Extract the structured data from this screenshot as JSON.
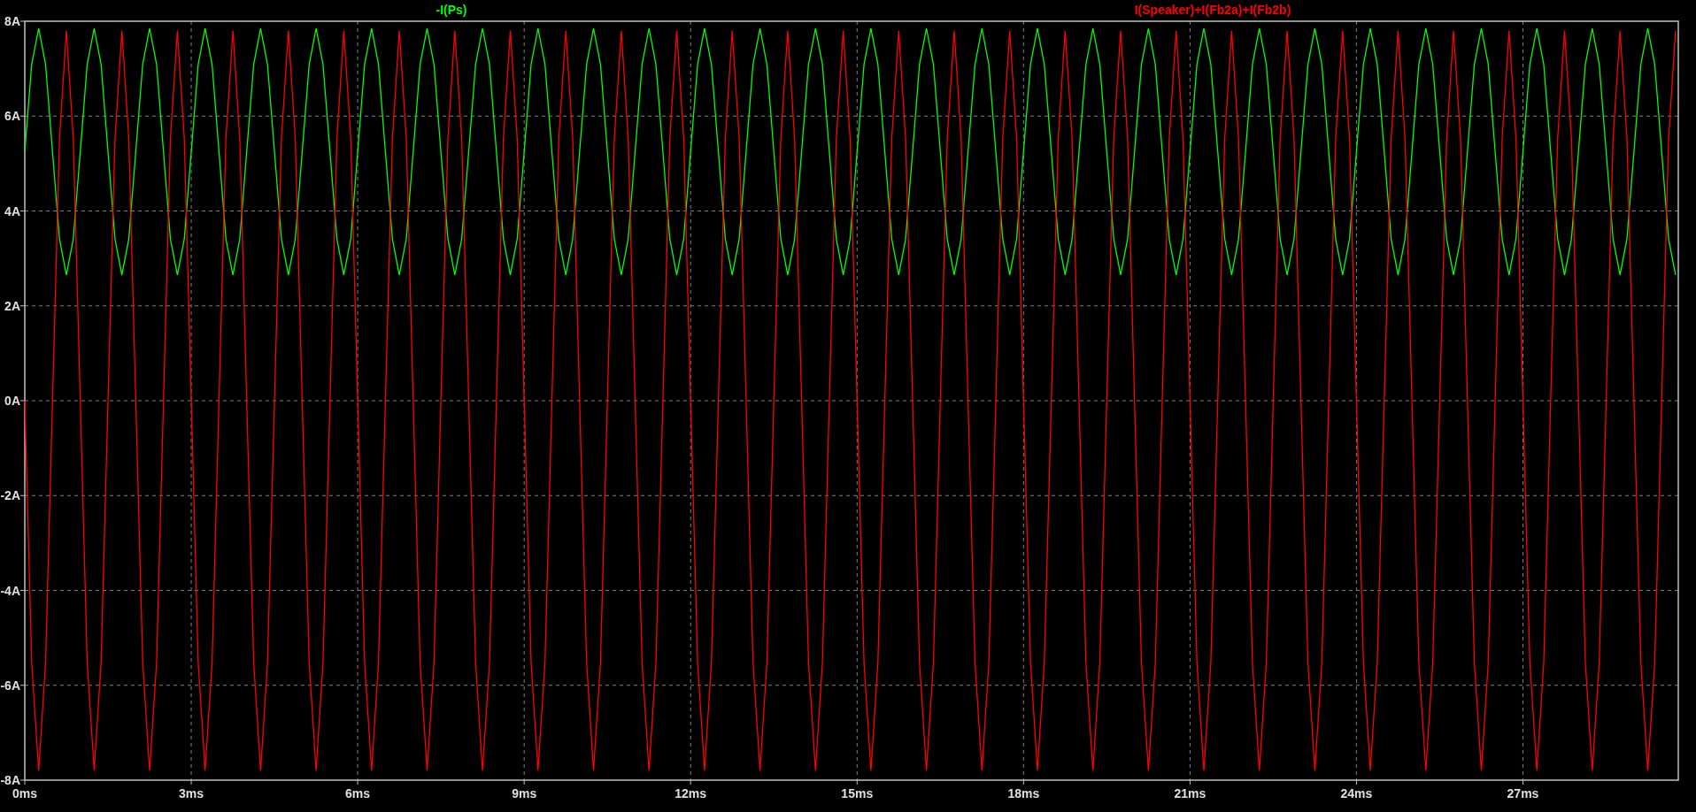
{
  "plot": {
    "chart_data": {
      "type": "line",
      "grid": true,
      "xlim": [
        0,
        29.8
      ],
      "ylim": [
        -8,
        8
      ],
      "xticks": [
        {
          "value": 0,
          "label": "0ms"
        },
        {
          "value": 3,
          "label": "3ms"
        },
        {
          "value": 6,
          "label": "6ms"
        },
        {
          "value": 9,
          "label": "9ms"
        },
        {
          "value": 12,
          "label": "12ms"
        },
        {
          "value": 15,
          "label": "15ms"
        },
        {
          "value": 18,
          "label": "18ms"
        },
        {
          "value": 21,
          "label": "21ms"
        },
        {
          "value": 24,
          "label": "24ms"
        },
        {
          "value": 27,
          "label": "27ms"
        }
      ],
      "yticks": [
        {
          "value": 8,
          "label": "8A"
        },
        {
          "value": 6,
          "label": "6A"
        },
        {
          "value": 4,
          "label": "4A"
        },
        {
          "value": 2,
          "label": "2A"
        },
        {
          "value": 0,
          "label": "0A"
        },
        {
          "value": -2,
          "label": "-2A"
        },
        {
          "value": -4,
          "label": "-4A"
        },
        {
          "value": -6,
          "label": "-6A"
        },
        {
          "value": -8,
          "label": "-8A"
        }
      ],
      "x": [
        0,
        0.125,
        0.25,
        0.375,
        0.5,
        0.625,
        0.75,
        0.875,
        1,
        1.125,
        1.25,
        1.375,
        1.5,
        1.625,
        1.75,
        1.875,
        2,
        2.125,
        2.25,
        2.375,
        2.5,
        2.625,
        2.75,
        2.875,
        3,
        3.125,
        3.25,
        3.375,
        3.5,
        3.625,
        3.75,
        3.875,
        4,
        4.125,
        4.25,
        4.375,
        4.5,
        4.625,
        4.75,
        4.875,
        5,
        5.125,
        5.25,
        5.375,
        5.5,
        5.625,
        5.75,
        5.875,
        6,
        6.125,
        6.25,
        6.375,
        6.5,
        6.625,
        6.75,
        6.875,
        7,
        7.125,
        7.25,
        7.375,
        7.5,
        7.625,
        7.75,
        7.875,
        8,
        8.125,
        8.25,
        8.375,
        8.5,
        8.625,
        8.75,
        8.875,
        9,
        9.125,
        9.25,
        9.375,
        9.5,
        9.625,
        9.75,
        9.875,
        10,
        10.125,
        10.25,
        10.375,
        10.5,
        10.625,
        10.75,
        10.875,
        11,
        11.125,
        11.25,
        11.375,
        11.5,
        11.625,
        11.75,
        11.875,
        12,
        12.125,
        12.25,
        12.375,
        12.5,
        12.625,
        12.75,
        12.875,
        13,
        13.125,
        13.25,
        13.375,
        13.5,
        13.625,
        13.75,
        13.875,
        14,
        14.125,
        14.25,
        14.375,
        14.5,
        14.625,
        14.75,
        14.875,
        15,
        15.125,
        15.25,
        15.375,
        15.5,
        15.625,
        15.75,
        15.875,
        16,
        16.125,
        16.25,
        16.375,
        16.5,
        16.625,
        16.75,
        16.875,
        17,
        17.125,
        17.25,
        17.375,
        17.5,
        17.625,
        17.75,
        17.875,
        18,
        18.125,
        18.25,
        18.375,
        18.5,
        18.625,
        18.75,
        18.875,
        19,
        19.125,
        19.25,
        19.375,
        19.5,
        19.625,
        19.75,
        19.875,
        20,
        20.125,
        20.25,
        20.375,
        20.5,
        20.625,
        20.75,
        20.875,
        21,
        21.125,
        21.25,
        21.375,
        21.5,
        21.625,
        21.75,
        21.875,
        22,
        22.125,
        22.25,
        22.375,
        22.5,
        22.625,
        22.75,
        22.875,
        23,
        23.125,
        23.25,
        23.375,
        23.5,
        23.625,
        23.75,
        23.875,
        24,
        24.125,
        24.25,
        24.375,
        24.5,
        24.625,
        24.75,
        24.875,
        25,
        25.125,
        25.25,
        25.375,
        25.5,
        25.625,
        25.75,
        25.875,
        26,
        26.125,
        26.25,
        26.375,
        26.5,
        26.625,
        26.75,
        26.875,
        27,
        27.125,
        27.25,
        27.375,
        27.5,
        27.625,
        27.75,
        27.875,
        28,
        28.125,
        28.25,
        28.375,
        28.5,
        28.625,
        28.75,
        28.875,
        29,
        29.125,
        29.25,
        29.375,
        29.5,
        29.625,
        29.75
      ],
      "series": [
        {
          "name": "-I(Ps)",
          "color": "#00ff00",
          "values": [
            5.25,
            7.09,
            7.85,
            7.09,
            5.25,
            3.41,
            2.65,
            3.41,
            5.25,
            7.09,
            7.85,
            7.09,
            5.25,
            3.41,
            2.65,
            3.41,
            5.25,
            7.09,
            7.85,
            7.09,
            5.25,
            3.41,
            2.65,
            3.41,
            5.25,
            7.09,
            7.85,
            7.09,
            5.25,
            3.41,
            2.65,
            3.41,
            5.25,
            7.09,
            7.85,
            7.09,
            5.25,
            3.41,
            2.65,
            3.41,
            5.25,
            7.09,
            7.85,
            7.09,
            5.25,
            3.41,
            2.65,
            3.41,
            5.25,
            7.09,
            7.85,
            7.09,
            5.25,
            3.41,
            2.65,
            3.41,
            5.25,
            7.09,
            7.85,
            7.09,
            5.25,
            3.41,
            2.65,
            3.41,
            5.25,
            7.09,
            7.85,
            7.09,
            5.25,
            3.41,
            2.65,
            3.41,
            5.25,
            7.09,
            7.85,
            7.09,
            5.25,
            3.41,
            2.65,
            3.41,
            5.25,
            7.09,
            7.85,
            7.09,
            5.25,
            3.41,
            2.65,
            3.41,
            5.25,
            7.09,
            7.85,
            7.09,
            5.25,
            3.41,
            2.65,
            3.41,
            5.25,
            7.09,
            7.85,
            7.09,
            5.25,
            3.41,
            2.65,
            3.41,
            5.25,
            7.09,
            7.85,
            7.09,
            5.25,
            3.41,
            2.65,
            3.41,
            5.25,
            7.09,
            7.85,
            7.09,
            5.25,
            3.41,
            2.65,
            3.41,
            5.25,
            7.09,
            7.85,
            7.09,
            5.25,
            3.41,
            2.65,
            3.41,
            5.25,
            7.09,
            7.85,
            7.09,
            5.25,
            3.41,
            2.65,
            3.41,
            5.25,
            7.09,
            7.85,
            7.09,
            5.25,
            3.41,
            2.65,
            3.41,
            5.25,
            7.09,
            7.85,
            7.09,
            5.25,
            3.41,
            2.65,
            3.41,
            5.25,
            7.09,
            7.85,
            7.09,
            5.25,
            3.41,
            2.65,
            3.41,
            5.25,
            7.09,
            7.85,
            7.09,
            5.25,
            3.41,
            2.65,
            3.41,
            5.25,
            7.09,
            7.85,
            7.09,
            5.25,
            3.41,
            2.65,
            3.41,
            5.25,
            7.09,
            7.85,
            7.09,
            5.25,
            3.41,
            2.65,
            3.41,
            5.25,
            7.09,
            7.85,
            7.09,
            5.25,
            3.41,
            2.65,
            3.41,
            5.25,
            7.09,
            7.85,
            7.09,
            5.25,
            3.41,
            2.65,
            3.41,
            5.25,
            7.09,
            7.85,
            7.09,
            5.25,
            3.41,
            2.65,
            3.41,
            5.25,
            7.09,
            7.85,
            7.09,
            5.25,
            3.41,
            2.65,
            3.41,
            5.25,
            7.09,
            7.85,
            7.09,
            5.25,
            3.41,
            2.65,
            3.41,
            5.25,
            7.09,
            7.85,
            7.09,
            5.25,
            3.41,
            2.65,
            3.41,
            5.25,
            7.09,
            7.85,
            7.09,
            5.25,
            3.41,
            2.65
          ]
        },
        {
          "name": "I(Speaker)+I(Fb2a)+I(Fb2b)",
          "color": "#ff0000",
          "values": [
            0,
            -5.52,
            -7.8,
            -5.52,
            0,
            5.52,
            7.8,
            5.52,
            0,
            -5.52,
            -7.8,
            -5.52,
            0,
            5.52,
            7.8,
            5.52,
            0,
            -5.52,
            -7.8,
            -5.52,
            0,
            5.52,
            7.8,
            5.52,
            0,
            -5.52,
            -7.8,
            -5.52,
            0,
            5.52,
            7.8,
            5.52,
            0,
            -5.52,
            -7.8,
            -5.52,
            0,
            5.52,
            7.8,
            5.52,
            0,
            -5.52,
            -7.8,
            -5.52,
            0,
            5.52,
            7.8,
            5.52,
            0,
            -5.52,
            -7.8,
            -5.52,
            0,
            5.52,
            7.8,
            5.52,
            0,
            -5.52,
            -7.8,
            -5.52,
            0,
            5.52,
            7.8,
            5.52,
            0,
            -5.52,
            -7.8,
            -5.52,
            0,
            5.52,
            7.8,
            5.52,
            0,
            -5.52,
            -7.8,
            -5.52,
            0,
            5.52,
            7.8,
            5.52,
            0,
            -5.52,
            -7.8,
            -5.52,
            0,
            5.52,
            7.8,
            5.52,
            0,
            -5.52,
            -7.8,
            -5.52,
            0,
            5.52,
            7.8,
            5.52,
            0,
            -5.52,
            -7.8,
            -5.52,
            0,
            5.52,
            7.8,
            5.52,
            0,
            -5.52,
            -7.8,
            -5.52,
            0,
            5.52,
            7.8,
            5.52,
            0,
            -5.52,
            -7.8,
            -5.52,
            0,
            5.52,
            7.8,
            5.52,
            0,
            -5.52,
            -7.8,
            -5.52,
            0,
            5.52,
            7.8,
            5.52,
            0,
            -5.52,
            -7.8,
            -5.52,
            0,
            5.52,
            7.8,
            5.52,
            0,
            -5.52,
            -7.8,
            -5.52,
            0,
            5.52,
            7.8,
            5.52,
            0,
            -5.52,
            -7.8,
            -5.52,
            0,
            5.52,
            7.8,
            5.52,
            0,
            -5.52,
            -7.8,
            -5.52,
            0,
            5.52,
            7.8,
            5.52,
            0,
            -5.52,
            -7.8,
            -5.52,
            0,
            5.52,
            7.8,
            5.52,
            0,
            -5.52,
            -7.8,
            -5.52,
            0,
            5.52,
            7.8,
            5.52,
            0,
            -5.52,
            -7.8,
            -5.52,
            0,
            5.52,
            7.8,
            5.52,
            0,
            -5.52,
            -7.8,
            -5.52,
            0,
            5.52,
            7.8,
            5.52,
            0,
            -5.52,
            -7.8,
            -5.52,
            0,
            5.52,
            7.8,
            5.52,
            0,
            -5.52,
            -7.8,
            -5.52,
            0,
            5.52,
            7.8,
            5.52,
            0,
            -5.52,
            -7.8,
            -5.52,
            0,
            5.52,
            7.8,
            5.52,
            0,
            -5.52,
            -7.8,
            -5.52,
            0,
            5.52,
            7.8,
            5.52,
            0,
            -5.52,
            -7.8,
            -5.52,
            0,
            5.52,
            7.8,
            5.52,
            0,
            -5.52,
            -7.8,
            -5.52,
            0,
            5.52,
            7.8
          ]
        }
      ]
    }
  }
}
